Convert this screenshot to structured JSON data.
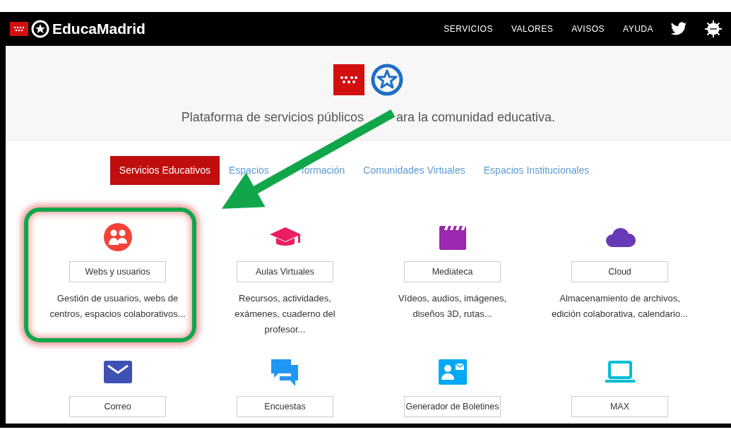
{
  "navbar": {
    "brand": "EducaMadrid",
    "links": [
      "SERVICIOS",
      "VALORES",
      "AVISOS",
      "AYUDA"
    ]
  },
  "hero": {
    "tagline": [
      "Plataforma de servicios públicos",
      "ara la comunidad educativa."
    ]
  },
  "tabs": [
    {
      "label": "Servicios Educativos",
      "selected": true
    },
    {
      "label": [
        "Espacios",
        "formación"
      ],
      "selected": false
    },
    {
      "label": "Comunidades Virtuales",
      "selected": false
    },
    {
      "label": "Espacios Institucionales",
      "selected": false
    }
  ],
  "services": [
    {
      "kind": "users",
      "color": "#f44336",
      "label": "Webs y usuarios",
      "description": "Gestión de usuarios, webs de centros, espacios colaborativos...",
      "highlighted": true
    },
    {
      "kind": "graduation",
      "color": "#e91e63",
      "label": "Aulas Virtuales",
      "description": "Recursos, actividades, exámenes, cuaderno del profesor...",
      "highlighted": false
    },
    {
      "kind": "film",
      "color": "#9c27b0",
      "label": "Mediateca",
      "description": "Vídeos, audios, imágenes, diseños 3D, rutas...",
      "highlighted": false
    },
    {
      "kind": "cloud",
      "color": "#673ab7",
      "label": "Cloud",
      "description": "Almacenamiento de archivos, edición colaborativa, calendario...",
      "highlighted": false
    },
    {
      "kind": "mail",
      "color": "#3f51b5",
      "label": "Correo",
      "highlighted": false
    },
    {
      "kind": "chat",
      "color": "#2196f3",
      "label": "Encuestas",
      "highlighted": false
    },
    {
      "kind": "contact",
      "color": "#03a9f4",
      "label": "Generador de Boletines",
      "highlighted": false
    },
    {
      "kind": "laptop",
      "color": "#00bcd4",
      "label": "MAX",
      "highlighted": false
    }
  ]
}
